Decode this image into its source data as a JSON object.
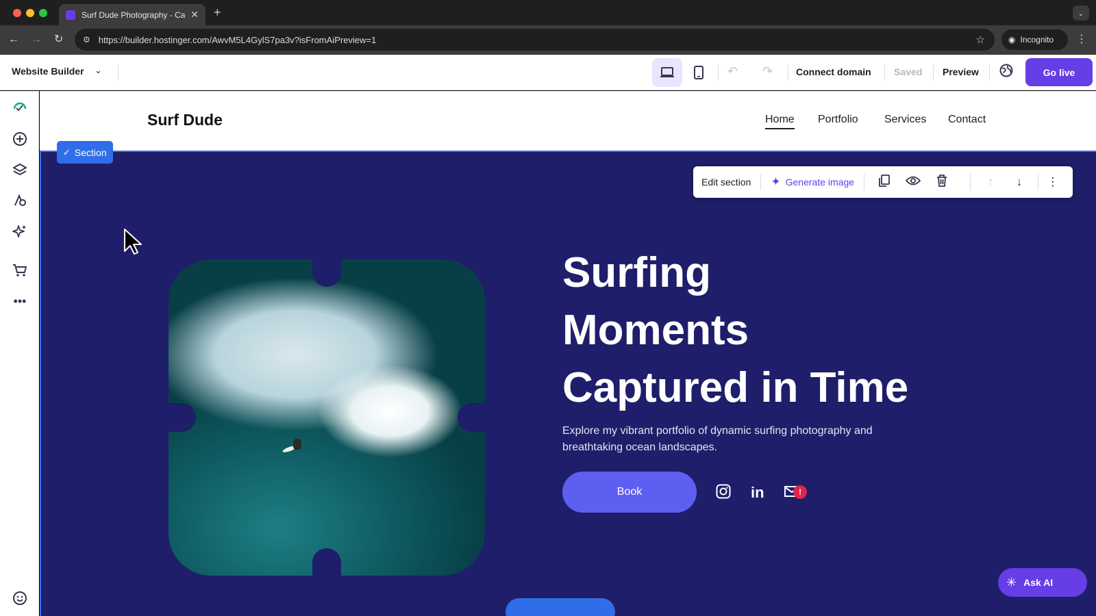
{
  "browser": {
    "tab_title": "Surf Dude Photography - Cap",
    "tab_close": "✕",
    "new_tab": "+",
    "tab_menu": "⌄",
    "url": "https://builder.hostinger.com/AwvM5L4GylS7pa3v?isFromAiPreview=1",
    "incognito_label": "Incognito",
    "icons": [
      "back-arrow-icon",
      "forward-arrow-icon",
      "reload-icon",
      "site-info-icon",
      "star-icon",
      "incognito-icon",
      "menu-icon"
    ]
  },
  "builder": {
    "title": "Website Builder",
    "connect_domain": "Connect domain",
    "saved": "Saved",
    "preview": "Preview",
    "go_live": "Go live",
    "accent_color": "#673de6"
  },
  "sidebar": {
    "icons": [
      "checklist-icon",
      "add-element-icon",
      "layers-icon",
      "design-icon",
      "ai-tools-icon",
      "store-icon",
      "more-icon",
      "help-icon"
    ]
  },
  "site": {
    "logo": "Surf Dude",
    "nav": [
      "Home",
      "Portfolio",
      "Services",
      "Contact"
    ],
    "hero_title_lines": [
      "Surfing",
      "Moments",
      "Captured in Time"
    ],
    "hero_description": "Explore my vibrant portfolio of dynamic surfing photography and breathtaking ocean landscapes.",
    "book_label": "Book",
    "linkedin_label": "in",
    "mail_alert": "!",
    "hero_bg_color": "#1e1e6a"
  },
  "editor": {
    "section_badge": "Section",
    "edit_section": "Edit section",
    "generate_image": "Generate image",
    "ask_ai": "Ask AI"
  }
}
